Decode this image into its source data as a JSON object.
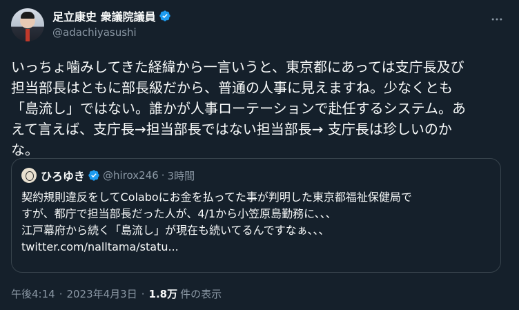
{
  "author": {
    "display_name": "足立康史 衆議院議員",
    "handle": "@adachiyasushi"
  },
  "tweet": {
    "text": "いっちょ噛みしてきた経緯から一言いうと、東京都にあっては支庁長及び\n担当部長はともに部長級だから、普通の人事に見えますね。少なくとも\n「島流し」ではない。誰かが人事ローテーションで赴任するシステム。あ\nえて言えば、支庁長→担当部長ではない担当部長→ 支庁長は珍しいのか\nな。"
  },
  "quoted_tweet": {
    "display_name": "ひろゆき",
    "handle": "@hirox246",
    "separator": "·",
    "time": "3時間",
    "text": "契約規則違反をしてColaboにお金を払ってた事が判明した東京都福祉保健局で\nすが、都庁で担当部長だった人が、4/1から小笠原島勤務に、、、\n江戸幕府から続く「島流し」が現在も続いてるんですなぁ、、、\ntwitter.com/nalltama/statu..."
  },
  "meta": {
    "time": "午後4:14",
    "date": "2023年4月3日",
    "separator": "·",
    "views_count": "1.8万",
    "views_label": "件の表示"
  },
  "colors": {
    "background": "#15202b",
    "text": "#f7f9f9",
    "secondary": "#8b98a5",
    "verified": "#1d9bf0",
    "border": "#38444d"
  },
  "icons": {
    "verified": "verified-badge-icon",
    "more": "more-options-icon"
  }
}
